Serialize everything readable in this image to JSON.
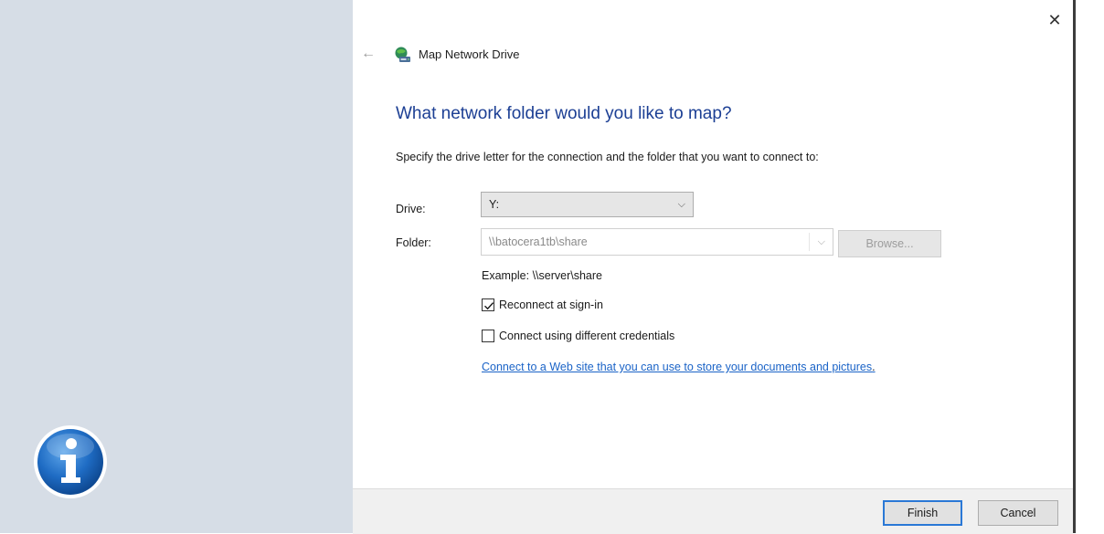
{
  "dialog": {
    "title": "Map Network Drive",
    "heading": "What network folder would you like to map?",
    "instructions": "Specify the drive letter for the connection and the folder that you want to connect to:",
    "drive": {
      "label": "Drive:",
      "selected": "Y:"
    },
    "folder": {
      "label": "Folder:",
      "value": "\\\\batocera1tb\\share"
    },
    "browse_label": "Browse...",
    "example": "Example: \\\\server\\share",
    "reconnect": {
      "label": "Reconnect at sign-in",
      "checked": true
    },
    "different_credentials": {
      "label": "Connect using different credentials",
      "checked": false
    },
    "web_link": "Connect to a Web site that you can use to store your documents and pictures",
    "web_link_suffix": ".",
    "finish_label": "Finish",
    "cancel_label": "Cancel"
  },
  "icons": {
    "close": "close-icon",
    "back": "back-arrow-icon",
    "title": "network-drive-icon",
    "info": "info-icon"
  },
  "colors": {
    "heading": "#1c3f94",
    "link": "#1a63c7",
    "left_panel": "#d6dde6",
    "footer": "#f0f0f0",
    "default_button_border": "#2a78d6"
  }
}
